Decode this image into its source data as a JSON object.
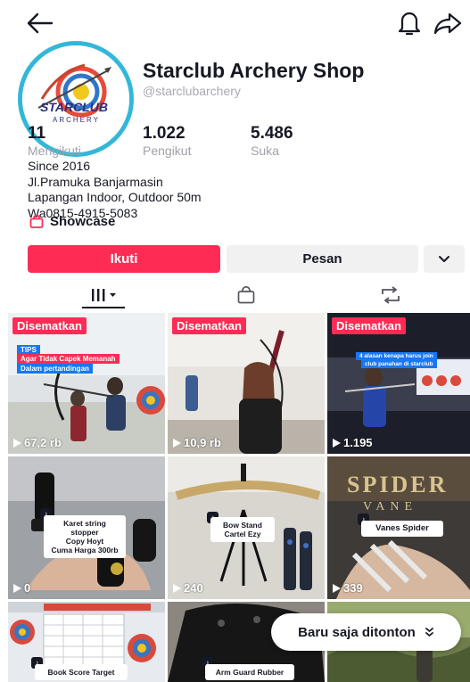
{
  "profile": {
    "name": "Starclub Archery Shop",
    "handle": "@starclubarchery",
    "logo_text_top": "STARCLUB",
    "logo_text_bottom": "ARCHERY"
  },
  "stats": [
    {
      "value": "11",
      "label": "Mengikuti"
    },
    {
      "value": "1.022",
      "label": "Pengikut"
    },
    {
      "value": "5.486",
      "label": "Suka"
    }
  ],
  "bio": [
    "Since 2016",
    "Jl.Pramuka Banjarmasin",
    "Lapangan Indoor, Outdoor 50m",
    "Wa0815-4915-5083"
  ],
  "showcase_label": "Showcase",
  "buttons": {
    "follow": "Ikuti",
    "message": "Pesan"
  },
  "icons": {
    "back": "arrow-left",
    "bell": "bell",
    "share": "share-arrow",
    "more": "chevron-down",
    "tab_videos": "grid-lines",
    "tab_shop": "shopping-bag",
    "tab_repost": "repost"
  },
  "colors": {
    "accent": "#fe2c55",
    "text": "#161823",
    "muted": "#a0a0a8",
    "button_bg": "#f1f1f2"
  },
  "videos": [
    {
      "pinned": "Disematkan",
      "views": "67,2 rb",
      "overlay": [
        "TIPS",
        "Agar Tidak Capek Memanah",
        "Dalam pertandingan"
      ]
    },
    {
      "pinned": "Disematkan",
      "views": "10,9 rb"
    },
    {
      "pinned": "Disematkan",
      "views": "1.195",
      "overlay": [
        "4 alasan kenapa harus join",
        "club panahan di starclub"
      ]
    },
    {
      "views": "0",
      "sticker": [
        "Karet string stopper",
        "Copy Hoyt",
        "Cuma Harga 300rb"
      ]
    },
    {
      "views": "240",
      "sticker": [
        "Bow Stand",
        "Cartel Ezy"
      ]
    },
    {
      "views": "339",
      "sticker": [
        "Vanes Spider"
      ]
    },
    {
      "sticker": [
        "Book Score Target"
      ]
    },
    {
      "sticker": [
        "Arm Guard Rubber"
      ]
    },
    {}
  ],
  "recent_button": "Baru saja ditonton"
}
